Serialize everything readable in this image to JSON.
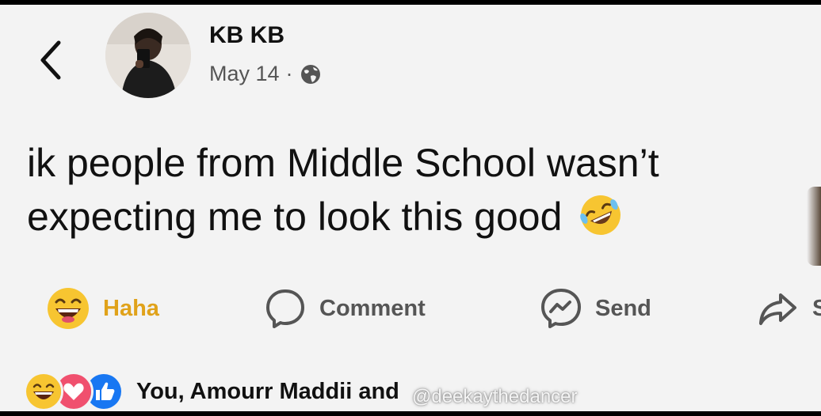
{
  "post": {
    "author": "KB KB",
    "date": "May 14",
    "separator": "·",
    "privacy_icon": "globe-icon",
    "text": "ik people from Middle School wasn’t expecting me to look this good",
    "text_emoji": "rolling-on-floor-laughing-emoji"
  },
  "actions": {
    "haha_label": "Haha",
    "comment_label": "Comment",
    "send_label": "Send",
    "share_label": "S"
  },
  "reactions": {
    "summary": "You, Amourr Maddii and",
    "icons": [
      "haha-emoji",
      "love-heart",
      "like-thumb"
    ]
  },
  "watermark": "@deekaythedancer",
  "colors": {
    "haha": "#e0a21a",
    "love": "#f0506e",
    "like": "#1877f2",
    "background": "#f3f3f3"
  }
}
